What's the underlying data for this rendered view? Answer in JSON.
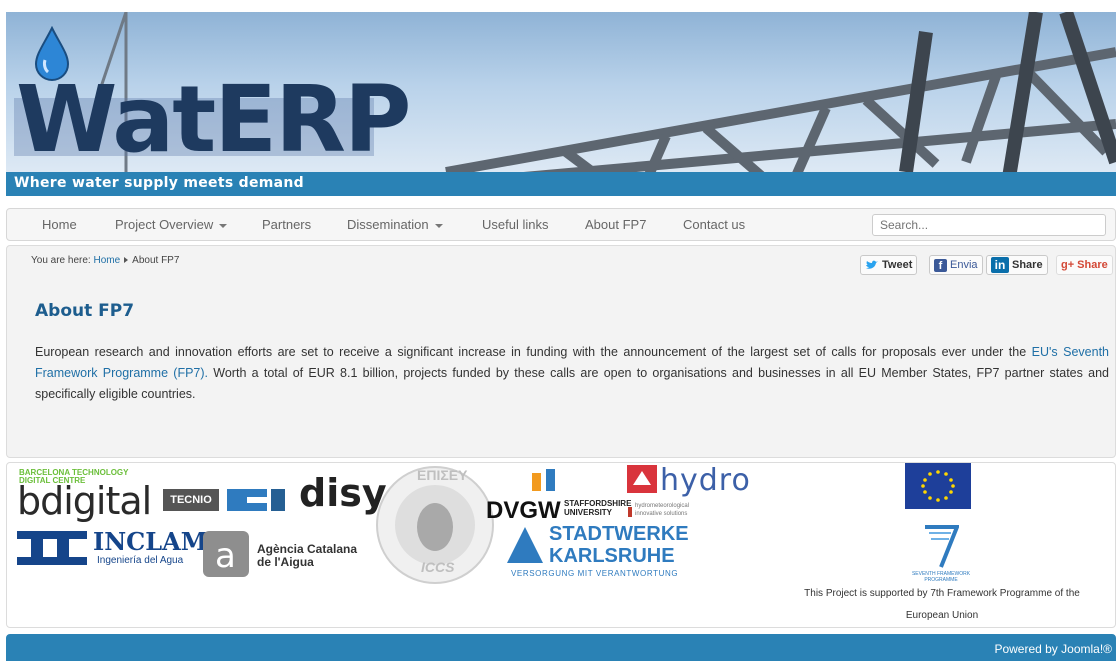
{
  "header": {
    "logo_text": "WatERP",
    "tagline": "Where water supply meets demand"
  },
  "nav": {
    "items": [
      {
        "label": "Home",
        "dropdown": false
      },
      {
        "label": "Project Overview",
        "dropdown": true
      },
      {
        "label": "Partners",
        "dropdown": false
      },
      {
        "label": "Dissemination",
        "dropdown": true
      },
      {
        "label": "Useful links",
        "dropdown": false
      },
      {
        "label": "About FP7",
        "dropdown": false
      },
      {
        "label": "Contact us",
        "dropdown": false
      }
    ],
    "search_placeholder": "Search..."
  },
  "breadcrumb": {
    "prefix": "You are here:",
    "home": "Home",
    "current": "About FP7"
  },
  "share": {
    "tweet": "Tweet",
    "facebook": "Envia",
    "linkedin": "Share",
    "google": "Share"
  },
  "article": {
    "title": "About FP7",
    "text_before_link": "European research and innovation efforts are set to receive a significant increase in funding with the announcement of the largest set of calls for proposals ever under the ",
    "link_text": "EU's Seventh Framework Programme (FP7).",
    "text_after_link": " Worth a total of EUR 8.1 billion, projects funded by these calls are open to organisations and businesses in all EU Member States, FP7 partner states and specifically eligible countries."
  },
  "partners": {
    "barcelona_line1": "BARCELONA TECHNOLOGY",
    "barcelona_line2": "DIGITAL       CENTRE",
    "bdigital": "bdigital",
    "tecnio": "TECNIO",
    "disy": "disy",
    "iccs_top": "ΕΠΙΣΕΥ",
    "iccs_bottom": "ICCS",
    "dvgw": "DVGW",
    "staffordshire": "STAFFORDSHIRE",
    "university": "UNIVERSITY",
    "hydro": "hydro",
    "hydro_sub1": "hydrometeorological",
    "hydro_sub2": "innovative solutions",
    "inclam": "INCLAM",
    "inclam_sub": "Ingeniería del Agua",
    "aca_line1": "Agència Catalana",
    "aca_line2": "de l'Aigua",
    "stadtwerke": "STADTWERKE",
    "karlsruhe": "KARLSRUHE",
    "versorgung": "VERSORGUNG MIT VERANTWORTUNG",
    "fp7_logo_text": "SEVENTH FRAMEWORK PROGRAMME",
    "support_line1": "This Project is supported by 7th Framework Programme of the",
    "support_line2": "European Union"
  },
  "footer": {
    "powered": "Powered by Joomla!®"
  },
  "colors": {
    "brand_blue": "#2a82b5",
    "title_blue": "#1d5d8e",
    "link_blue": "#1f6fa6"
  }
}
